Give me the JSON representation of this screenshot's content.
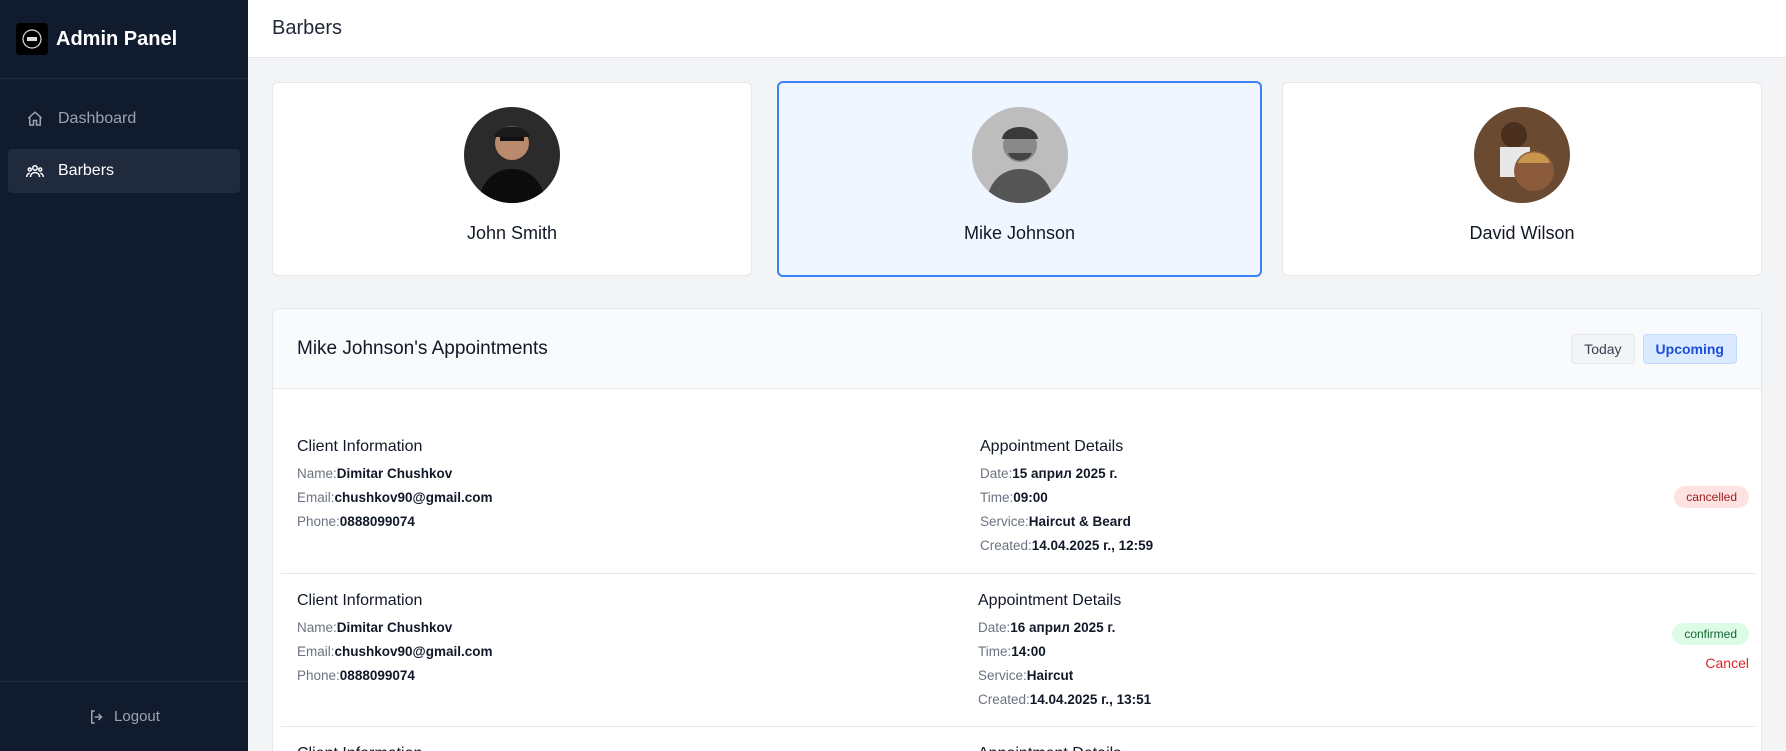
{
  "sidebar": {
    "title": "Admin Panel",
    "items": [
      {
        "label": "Dashboard",
        "icon": "home-icon",
        "active": false
      },
      {
        "label": "Barbers",
        "icon": "users-icon",
        "active": true
      }
    ],
    "logout_label": "Logout"
  },
  "header": {
    "title": "Barbers"
  },
  "barbers": [
    {
      "name": "John Smith",
      "selected": false
    },
    {
      "name": "Mike Johnson",
      "selected": true
    },
    {
      "name": "David Wilson",
      "selected": false
    }
  ],
  "appointments": {
    "title": "Mike Johnson's Appointments",
    "filters": [
      {
        "label": "Today",
        "active": false
      },
      {
        "label": "Upcoming",
        "active": true
      }
    ],
    "client_section_title": "Client Information",
    "details_section_title": "Appointment Details",
    "labels": {
      "name": "Name:",
      "email": "Email:",
      "phone": "Phone:",
      "date": "Date:",
      "time": "Time:",
      "service": "Service:",
      "created": "Created:"
    },
    "cancel_label": "Cancel",
    "rows": [
      {
        "client_name": "Dimitar Chushkov",
        "email": "chushkov90@gmail.com",
        "phone": "0888099074",
        "date": "15 април 2025 г.",
        "time": "09:00",
        "service": "Haircut & Beard",
        "created": "14.04.2025 г., 12:59",
        "status": "cancelled"
      },
      {
        "client_name": "Dimitar Chushkov",
        "email": "chushkov90@gmail.com",
        "phone": "0888099074",
        "date": "16 април 2025 г.",
        "time": "14:00",
        "service": "Haircut",
        "created": "14.04.2025 г., 13:51",
        "status": "confirmed"
      }
    ]
  },
  "colors": {
    "sidebar_bg": "#111b2e",
    "accent": "#3b82f6",
    "cancelled": "#991b1b",
    "confirmed": "#166534",
    "cancel_link": "#dc2626"
  }
}
